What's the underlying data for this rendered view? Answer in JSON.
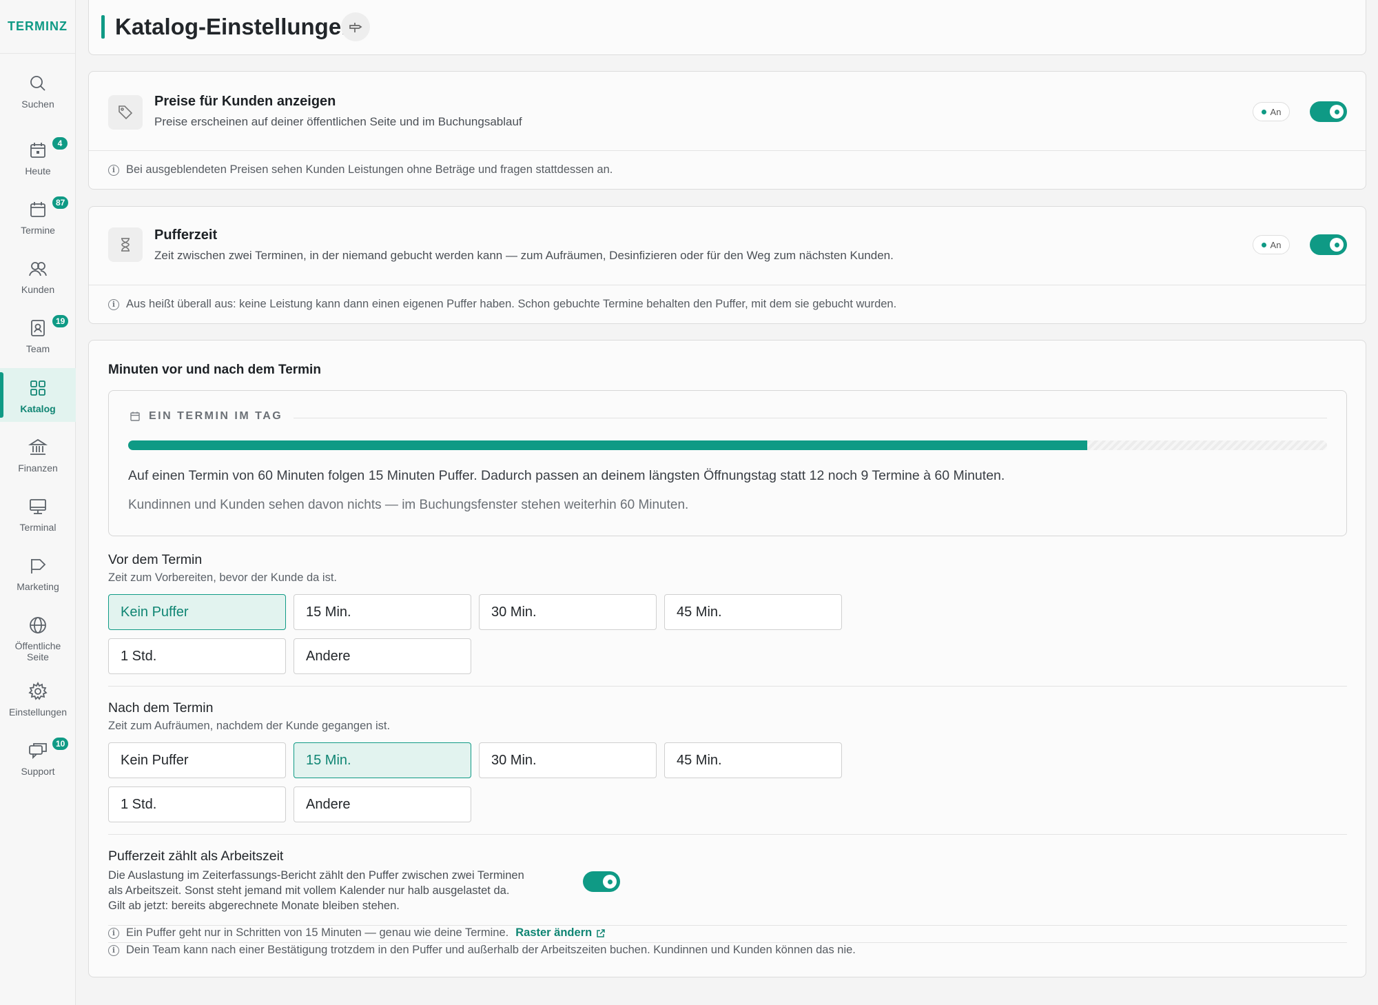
{
  "app": {
    "logo": "TERMINZ"
  },
  "sidebar": {
    "items": [
      {
        "label": "Suchen",
        "icon": "search-icon"
      },
      {
        "label": "Heute",
        "icon": "calendar-today-icon",
        "badge": "4"
      },
      {
        "label": "Termine",
        "icon": "calendar-icon",
        "badge": "87"
      },
      {
        "label": "Kunden",
        "icon": "users-icon"
      },
      {
        "label": "Team",
        "icon": "id-badge-icon",
        "badge": "19"
      },
      {
        "label": "Katalog",
        "icon": "grid-icon",
        "active": true
      },
      {
        "label": "Finanzen",
        "icon": "bank-icon"
      },
      {
        "label": "Terminal",
        "icon": "monitor-icon"
      },
      {
        "label": "Marketing",
        "icon": "megaphone-icon"
      },
      {
        "label": "Öffentliche Seite",
        "icon": "globe-icon"
      },
      {
        "label": "Einstellungen",
        "icon": "gear-icon"
      },
      {
        "label": "Support",
        "icon": "chat-icon",
        "badge": "10"
      }
    ]
  },
  "header": {
    "title": "Katalog-Einstellungen",
    "pin_icon": "pin-icon"
  },
  "prices": {
    "title": "Preise für Kunden anzeigen",
    "description": "Preise erscheinen auf deiner öffentlichen Seite und im Buchungsablauf",
    "status": "An",
    "enabled": true,
    "info": "Bei ausgeblendeten Preisen sehen Kunden Leistungen ohne Beträge und fragen stattdessen an."
  },
  "buffer": {
    "title": "Pufferzeit",
    "description": "Zeit zwischen zwei Terminen, in der niemand gebucht werden kann — zum Aufräumen, Desinfizieren oder für den Weg zum nächsten Kunden.",
    "status": "An",
    "enabled": true,
    "info": "Aus heißt überall aus: keine Leistung kann dann einen eigenen Puffer haben. Schon gebuchte Termine behalten den Puffer, mit dem sie gebucht wurden."
  },
  "minutes": {
    "heading": "Minuten vor und nach dem Termin",
    "preview": {
      "label": "EIN TERMIN IM TAG",
      "progress_fraction": 0.8,
      "text1": "Auf einen Termin von 60 Minuten folgen 15 Minuten Puffer. Dadurch passen an deinem längsten Öffnungstag statt 12 noch 9 Termine à 60 Minuten.",
      "text2": "Kundinnen und Kunden sehen davon nichts — im Buchungsfenster stehen weiterhin 60 Minuten."
    },
    "before": {
      "title": "Vor dem Termin",
      "subtitle": "Zeit zum Vorbereiten, bevor der Kunde da ist.",
      "options": [
        "Kein Puffer",
        "15 Min.",
        "30 Min.",
        "45 Min.",
        "1 Std.",
        "Andere"
      ],
      "selected": "Kein Puffer"
    },
    "after": {
      "title": "Nach dem Termin",
      "subtitle": "Zeit zum Aufräumen, nachdem der Kunde gegangen ist.",
      "options": [
        "Kein Puffer",
        "15 Min.",
        "30 Min.",
        "45 Min.",
        "1 Std.",
        "Andere"
      ],
      "selected": "15 Min."
    },
    "worktime": {
      "title": "Pufferzeit zählt als Arbeitszeit",
      "description": "Die Auslastung im Zeiterfassungs-Bericht zählt den Puffer zwischen zwei Terminen als Arbeitszeit. Sonst steht jemand mit vollem Kalender nur halb ausgelastet da. Gilt ab jetzt: bereits abgerechnete Monate bleiben stehen.",
      "enabled": true
    },
    "note1": "Ein Puffer geht nur in Schritten von 15 Minuten — genau wie deine Termine.",
    "note1_link": "Raster ändern",
    "note2": "Dein Team kann nach einer Bestätigung trotzdem in den Puffer und außerhalb der Arbeitszeiten buchen. Kundinnen und Kunden können das nie."
  },
  "colors": {
    "accent": "#0f9a85",
    "accent_light": "#e2f3ef"
  }
}
